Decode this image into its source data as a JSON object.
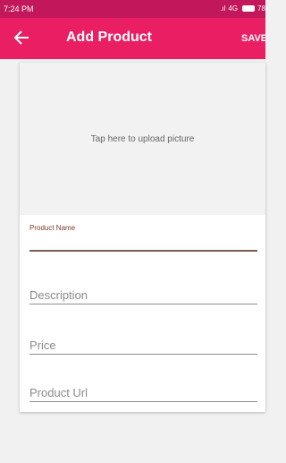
{
  "status_bar": {
    "time": "7:24 PM",
    "network": "4G",
    "battery": "78"
  },
  "app_bar": {
    "back_icon": "arrow-left-icon",
    "title": "Add Product",
    "save_label": "SAVE"
  },
  "upload": {
    "label": "Tap here to upload picture"
  },
  "form": {
    "product_name": {
      "label": "Product Name",
      "value": ""
    },
    "description": {
      "placeholder": "Description"
    },
    "price": {
      "placeholder": "Price"
    },
    "product_url": {
      "placeholder": "Product Url"
    }
  },
  "colors": {
    "status_bar": "#c2185b",
    "app_bar": "#e91e63",
    "accent_underline": "#7b5a52"
  }
}
